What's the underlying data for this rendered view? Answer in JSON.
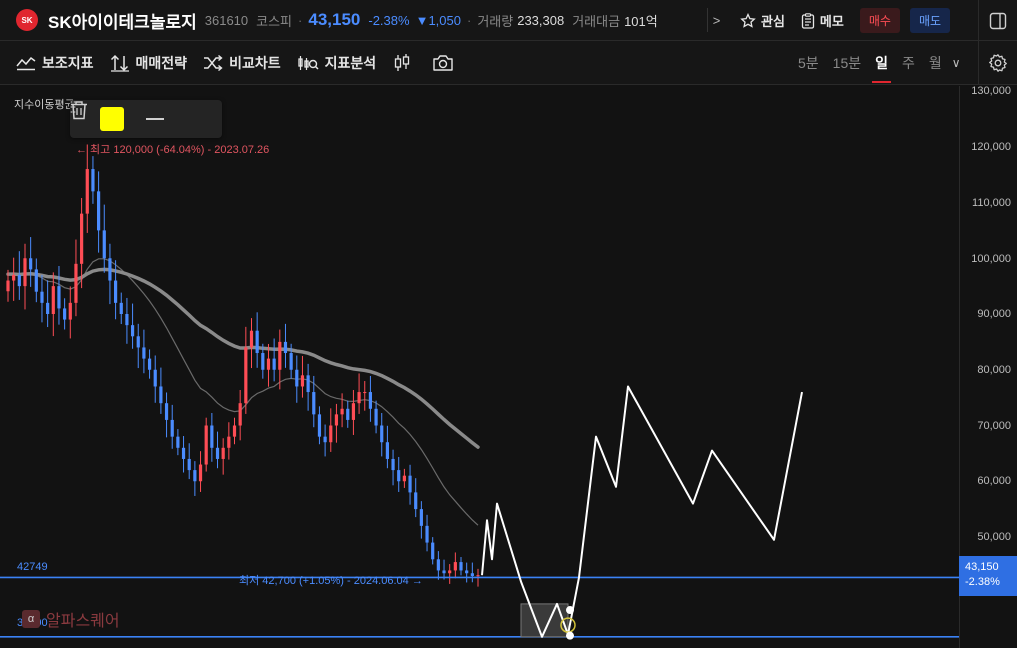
{
  "header": {
    "logo_text": "SK",
    "stock_name": "SK아이이테크놀로지",
    "stock_code": "361610",
    "market": "코스피",
    "separator": "·",
    "price": "43,150",
    "change_pct": "-2.38%",
    "change_abs": "▼1,050",
    "volume_label": "거래량",
    "volume_value": "233,308",
    "amount_label": "거래대금",
    "amount_value": "101억",
    "chevron": ">",
    "watch_label": "관심",
    "memo_label": "메모",
    "buy_label": "매수",
    "sell_label": "매도"
  },
  "toolbar": {
    "tools": [
      {
        "label": "보조지표",
        "icon": "indicator-icon"
      },
      {
        "label": "매매전략",
        "icon": "strategy-icon"
      },
      {
        "label": "비교차트",
        "icon": "compare-icon"
      },
      {
        "label": "지표분석",
        "icon": "analysis-icon"
      }
    ],
    "periods": [
      "5분",
      "15분",
      "일",
      "주",
      "월"
    ],
    "active_period": "일",
    "period_chevron": "∨"
  },
  "chart": {
    "indicator_label": "지수이동평균",
    "drawing_color": "#ffff00",
    "high_annotation": "← 최고 120,000 (-64.04%) - 2023.07.26",
    "low_annotation": "최저 42,700 (+1.05%) - 2024.06.04 →",
    "hline_upper_label": "42749",
    "hline_lower_label": "32100",
    "watermark": "알파스퀘어",
    "watermark_icon": "α",
    "current_price": "43,150",
    "current_change": "-2.38%",
    "y_ticks": [
      "130,000",
      "120,000",
      "110,000",
      "100,000",
      "90,000",
      "80,000",
      "70,000",
      "60,000",
      "50,000"
    ]
  },
  "chart_data": {
    "type": "candlestick",
    "ylim": [
      32000,
      130000
    ],
    "y_ticks": [
      130000,
      120000,
      110000,
      100000,
      90000,
      80000,
      70000,
      60000,
      50000
    ],
    "closes": [
      96000,
      97000,
      95000,
      100000,
      98000,
      94000,
      92000,
      90000,
      95000,
      91000,
      89000,
      92000,
      99000,
      108000,
      116000,
      112000,
      105000,
      100000,
      96000,
      92000,
      90000,
      88000,
      86000,
      84000,
      82000,
      80000,
      77000,
      74000,
      71000,
      68000,
      66000,
      64000,
      62000,
      60000,
      63000,
      70000,
      66000,
      64000,
      66000,
      68000,
      70000,
      74000,
      84000,
      87000,
      83000,
      80000,
      82000,
      80000,
      85000,
      83000,
      80000,
      77000,
      79000,
      76000,
      72000,
      68000,
      67000,
      70000,
      72000,
      73000,
      71000,
      74000,
      76000,
      76000,
      73000,
      70000,
      67000,
      64000,
      62000,
      60000,
      61000,
      58000,
      55000,
      52000,
      49000,
      46000,
      44000,
      43500,
      44000,
      45500,
      44000,
      43500,
      43000,
      43150
    ],
    "ema_long_start": 87000,
    "ema_long_end": 67000,
    "high": {
      "value": 120000,
      "pct": -64.04,
      "date": "2023.07.26"
    },
    "low": {
      "value": 42700,
      "pct": 1.05,
      "date": "2024.06.04"
    },
    "horizontal_lines": [
      42749,
      32100
    ],
    "current_price": 43150,
    "projected_path": [
      43150,
      53000,
      46000,
      56000,
      42000,
      32100,
      38000,
      32500,
      42749,
      68000,
      59000,
      77000,
      56000,
      65500,
      49500,
      76000
    ]
  }
}
